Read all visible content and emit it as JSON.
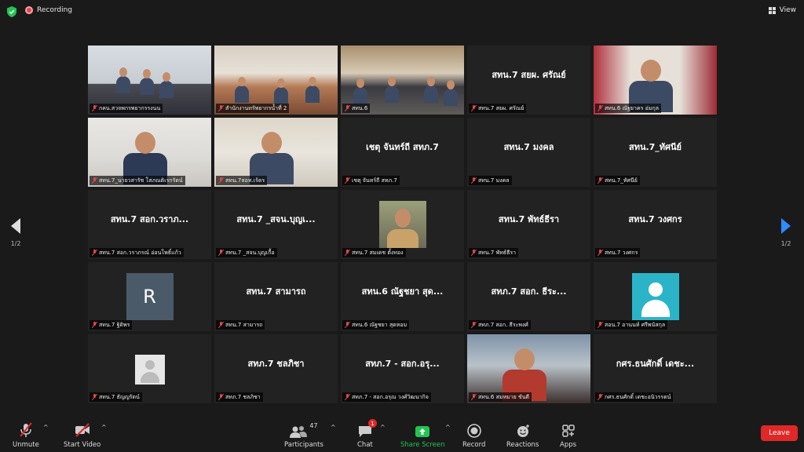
{
  "top": {
    "recording_label": "Recording",
    "view_label": "View"
  },
  "colors": {
    "accent": "#2d8cff",
    "leave": "#e02828",
    "active_outline": "#cfd86a",
    "share": "#23c552"
  },
  "tiles": [
    {
      "name": "",
      "label": "กคน.สวจพกรพยากรรงนน",
      "kind": "video",
      "scene": "room1",
      "active": true
    },
    {
      "name": "",
      "label": "สำนักงานทรัพยากรน้ำที่ 2",
      "kind": "video",
      "scene": "room2"
    },
    {
      "name": "",
      "label": "สทน.6",
      "kind": "video",
      "scene": "room3"
    },
    {
      "name": "สทน.7 สยผ. ศรัณย์",
      "label": "สทน.7 สยผ. ศรัณย์",
      "kind": "name"
    },
    {
      "name": "",
      "label": "สทน.6 ณัฐยาคร อ่มกุล",
      "kind": "video",
      "scene": "room4"
    },
    {
      "name": "",
      "label": "สทน.7_นายวสารัช โสภณติเรกรัตน์",
      "kind": "video",
      "scene": "room5"
    },
    {
      "name": "",
      "label": "สทน.7สอท.เร้ดร",
      "kind": "video",
      "scene": "room6"
    },
    {
      "name": "เชตุ จันทร์ถี สทภ.7",
      "label": "เชตุ จันทร์ถี สทภ.7",
      "kind": "name"
    },
    {
      "name": "สทน.7 มงคล",
      "label": "สทน.7 มงคล",
      "kind": "name"
    },
    {
      "name": "สทน.7_ทัศนีย์",
      "label": "สทน.7_ทัศนีย์",
      "kind": "name"
    },
    {
      "name": "สทน.7 สอก.วราภ...",
      "label": "สทน.7 สอก.วราภรณ์ อ่อนโพธิ์แก้ว",
      "kind": "name"
    },
    {
      "name": "สทน.7 _สจน.บุญเ...",
      "label": "สทน.7 _สจน.บุญเกื้อ",
      "kind": "name"
    },
    {
      "name": "",
      "label": "สทน.7 สมเดช ตั้งทอง",
      "kind": "photo"
    },
    {
      "name": "สทน.7 พัทธ์ธีรา",
      "label": "สทน.7 พัทธ์ธีรา",
      "kind": "name"
    },
    {
      "name": "สทน.7 วงศกร",
      "label": "สทน.7 วงศกร",
      "kind": "name"
    },
    {
      "name": "R",
      "label": "สทน.7 ฐิติพร",
      "kind": "avatar-r"
    },
    {
      "name": "สทน.7 สามารถ",
      "label": "สทน.7 สามารถ",
      "kind": "name"
    },
    {
      "name": "สทน.6 ณัฐชยา สุด...",
      "label": "สทน.6 ณัฐชยา สุดหอม",
      "kind": "name"
    },
    {
      "name": "สทภ.7 สอก. ธีระ...",
      "label": "สทภ.7 สอก. ธีระพงศ์",
      "kind": "name"
    },
    {
      "name": "",
      "label": "สอน.7 อานนท์ ศรีพนัสกุล",
      "kind": "avatar-person"
    },
    {
      "name": "",
      "label": "สทน.7 ธัญญรัตน์",
      "kind": "avatar-gray"
    },
    {
      "name": "สทภ.7 ชลภิชา",
      "label": "สทภ.7 ชลภิชา",
      "kind": "name"
    },
    {
      "name": "สทภ.7 - สอก.อรุ...",
      "label": "สทภ.7 - สอก.อรุณ วงศ์วิฒนากิจ",
      "kind": "name"
    },
    {
      "name": "",
      "label": "สทน.6 สมหมาย ขันตี",
      "kind": "video",
      "scene": "room7"
    },
    {
      "name": "กศร.ธนศักดิ์ เดชะ...",
      "label": "กศร.ธนศักดิ์ เดชะอนิวรรตน์",
      "kind": "name"
    }
  ],
  "pager": {
    "left": "1/2",
    "right": "1/2"
  },
  "toolbar": {
    "unmute": "Unmute",
    "start_video": "Start Video",
    "participants": "Participants",
    "participants_count": "47",
    "chat": "Chat",
    "chat_badge": "1",
    "share": "Share Screen",
    "record": "Record",
    "reactions": "Reactions",
    "apps": "Apps",
    "leave": "Leave"
  }
}
